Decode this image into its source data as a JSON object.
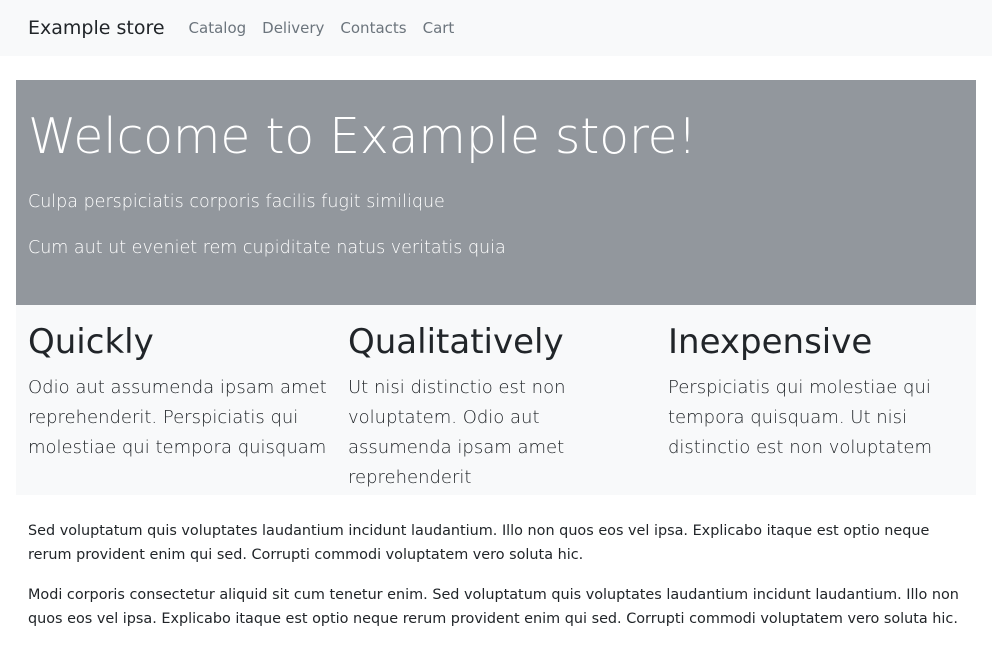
{
  "navbar": {
    "brand": "Example store",
    "links": [
      "Catalog",
      "Delivery",
      "Contacts",
      "Cart"
    ]
  },
  "hero": {
    "title": "Welcome to Example store!",
    "lines": [
      "Culpa perspiciatis corporis facilis fugit similique",
      "Cum aut ut eveniet rem cupiditate natus veritatis quia"
    ]
  },
  "features": [
    {
      "title": "Quickly",
      "text": "Odio aut assumenda ipsam amet reprehenderit. Perspiciatis qui molestiae qui tempora quisquam"
    },
    {
      "title": "Qualitatively",
      "text": "Ut nisi distinctio est non voluptatem. Odio aut assumenda ipsam amet reprehenderit"
    },
    {
      "title": "Inexpensive",
      "text": "Perspiciatis qui molestiae qui tempora quisquam. Ut nisi distinctio est non voluptatem"
    }
  ],
  "paragraphs": [
    "Sed voluptatum quis voluptates laudantium incidunt laudantium. Illo non quos eos vel ipsa. Explicabo itaque est optio neque rerum provident enim qui sed. Corrupti commodi voluptatem vero soluta hic.",
    "Modi corporis consectetur aliquid sit cum tenetur enim. Sed voluptatum quis voluptates laudantium incidunt laudantium. Illo non quos eos vel ipsa. Explicabo itaque est optio neque rerum provident enim qui sed. Corrupti commodi voluptatem vero soluta hic."
  ],
  "colors": {
    "navbar_bg": "#f8f9fa",
    "hero_bg": "#92979d",
    "features_bg": "#f8f9fa",
    "nav_link": "#6c757d",
    "text": "#212529"
  }
}
